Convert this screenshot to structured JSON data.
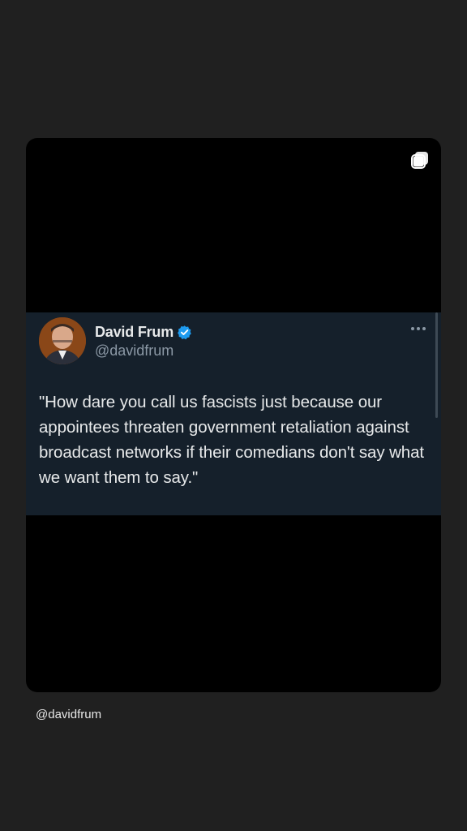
{
  "tweet": {
    "display_name": "David Frum",
    "handle": "@davidfrum",
    "verified_color": "#1d9bf0",
    "text": "\"How dare you call us fascists just because our appointees threaten government retaliation against broadcast networks if their comedians don't say what we want them to say.\"",
    "menu_icon": "more-horizontal-icon"
  },
  "post": {
    "multi_media_icon": "multiple-images-icon",
    "username": "@davidfrum"
  },
  "colors": {
    "page_background": "#202020",
    "frame_background": "#000000",
    "card_background": "#15202b",
    "primary_text": "#e7e9ea",
    "secondary_text": "#8b98a5"
  }
}
